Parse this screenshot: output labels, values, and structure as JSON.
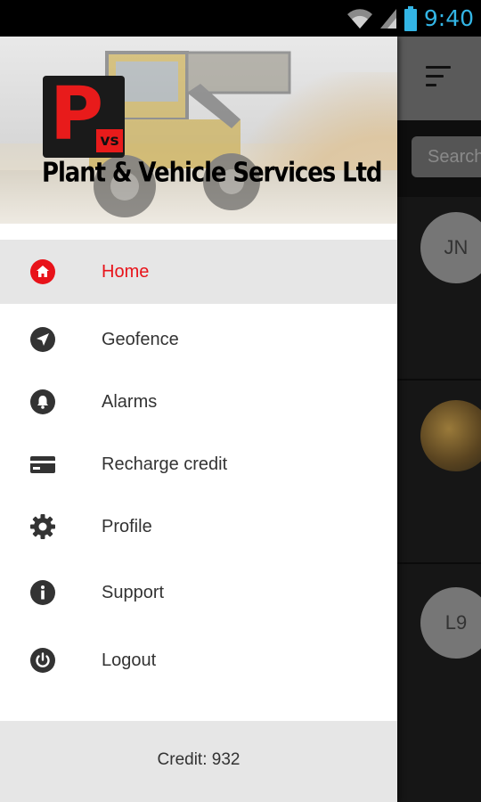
{
  "status_bar": {
    "time": "9:40"
  },
  "drawer": {
    "company_name": "Plant & Vehicle Services Ltd",
    "logo": {
      "letter": "P",
      "sub": "vs"
    },
    "menu_items": [
      {
        "label": "Home",
        "icon": "home-icon",
        "active": true
      },
      {
        "label": "Geofence",
        "icon": "navigation-arrow-icon",
        "active": false
      },
      {
        "label": "Alarms",
        "icon": "bell-icon",
        "active": false
      },
      {
        "label": "Recharge credit",
        "icon": "credit-card-icon",
        "active": false
      },
      {
        "label": "Profile",
        "icon": "gear-icon",
        "active": false
      },
      {
        "label": "Support",
        "icon": "info-icon",
        "active": false
      },
      {
        "label": "Logout",
        "icon": "power-icon",
        "active": false
      }
    ],
    "footer": {
      "credit_label": "Credit:",
      "credit_value": "932"
    }
  },
  "background": {
    "search_placeholder": "Search",
    "avatars": [
      "JN",
      "",
      "L9"
    ]
  },
  "colors": {
    "accent": "#e8131a",
    "active_bg": "#e6e6e6",
    "icon": "#333333"
  }
}
